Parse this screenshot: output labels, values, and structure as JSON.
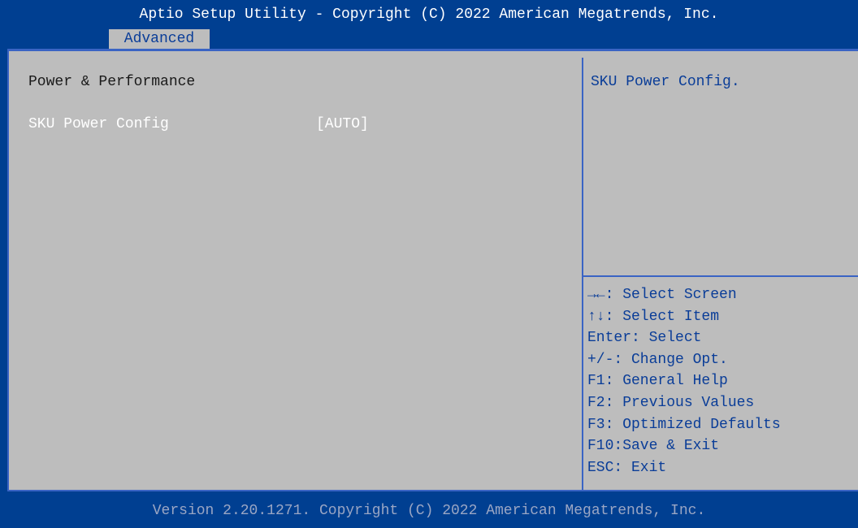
{
  "header": {
    "title": "Aptio Setup Utility - Copyright (C) 2022 American Megatrends, Inc.",
    "active_tab": "Advanced"
  },
  "main": {
    "section_title": "Power & Performance",
    "options": [
      {
        "label": "SKU Power Config",
        "value": "[AUTO]"
      }
    ]
  },
  "help": {
    "text": "SKU Power Config.",
    "keys": [
      "→←: Select Screen",
      "↑↓: Select Item",
      "Enter: Select",
      "+/-: Change Opt.",
      "F1: General Help",
      "F2: Previous Values",
      "F3: Optimized Defaults",
      "F10:Save & Exit",
      "ESC: Exit"
    ]
  },
  "footer": {
    "version": "Version 2.20.1271. Copyright (C) 2022 American Megatrends, Inc."
  },
  "colors": {
    "background": "#003f91",
    "panel": "#bdbdbd",
    "accent_text": "#0a3d98",
    "highlight_text": "#ffffff"
  }
}
